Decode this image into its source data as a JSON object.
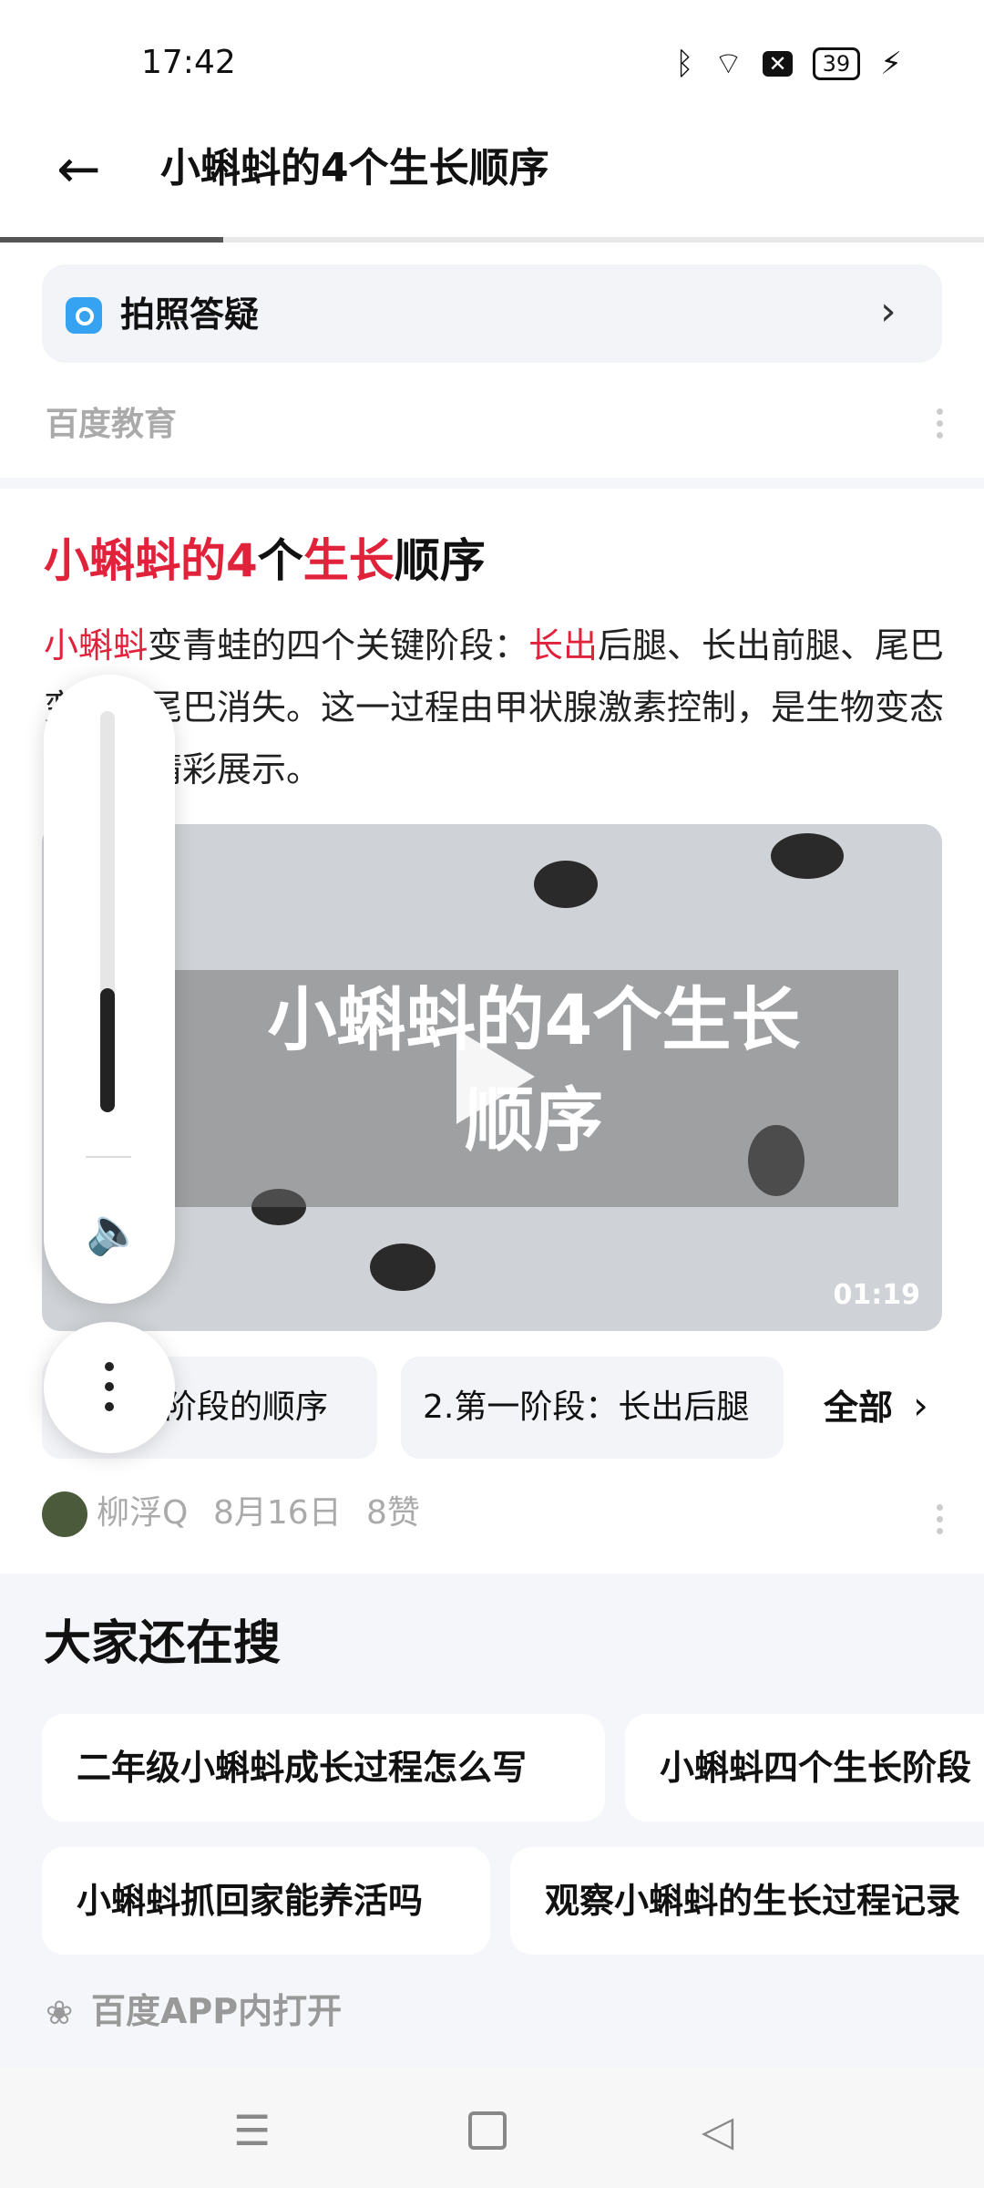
{
  "status_bar": {
    "time": "17:42",
    "battery": "39",
    "icons": [
      "bluetooth-icon",
      "wifi-icon",
      "sim-off-icon",
      "battery-icon",
      "charging-icon"
    ]
  },
  "header": {
    "back_icon": "arrow-left-icon",
    "title": "小蝌蚪的4个生长顺序"
  },
  "photo_qa": {
    "label": "拍照答疑"
  },
  "source_1": "百度教育",
  "result": {
    "title_parts": [
      "小蝌蚪",
      "的4",
      "个",
      "生长",
      "顺序"
    ],
    "body_parts": [
      "小蝌蚪",
      "变青蛙的四个关键阶段：",
      "长出",
      "后腿、长出前腿、尾巴变短、尾巴消失。这一过程由甲状腺激素控制，是生物变态发育的精彩展示。"
    ],
    "video": {
      "overlay_text_line1": "小蝌蚪的4个生长",
      "overlay_text_line2": "顺序",
      "duration": "01:19"
    },
    "chapters": [
      {
        "label": "阶段的顺序"
      },
      {
        "label": "2.第一阶段：长出后腿"
      }
    ],
    "all_label": "全部",
    "author": "柳浮Q",
    "date": "8月16日",
    "likes": "8赞"
  },
  "also_search": {
    "title": "大家还在搜",
    "tags": [
      "二年级小蝌蚪成长过程怎么写",
      "小蝌蚪四个生长阶段",
      "小蝌蚪抓回家能养活吗",
      "观察小蝌蚪的生长过程记录"
    ]
  },
  "open_app": "百度APP内打开",
  "volume": {
    "level": 0.31
  }
}
